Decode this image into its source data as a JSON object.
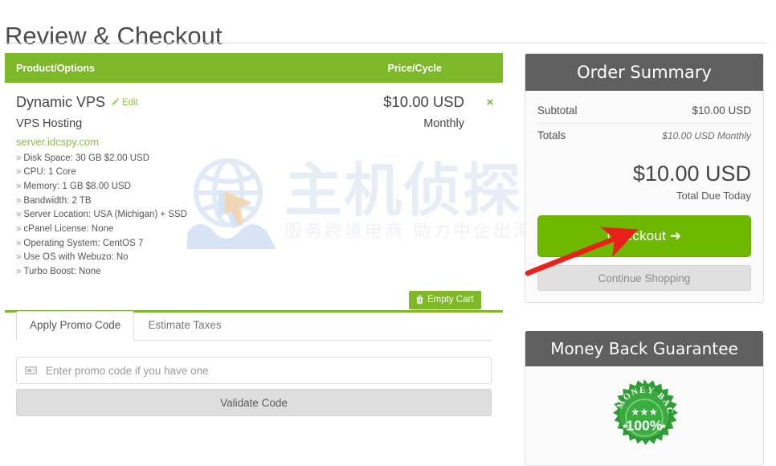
{
  "page": {
    "title": "Review & Checkout"
  },
  "watermark": {
    "main_text": "主机侦探",
    "sub_text": "服务跨境电商  助力中企出海",
    "globe_icon": "globe-cursor-wave-icon",
    "color": "#e6edf7"
  },
  "colors": {
    "brand_green": "#7cb828",
    "checkout_green": "#6fb800",
    "panel_gray": "#5f5f5f",
    "link_green": "#8cc63e",
    "domain_green": "#8cb847",
    "annotation_red": "#e8211a"
  },
  "cart": {
    "columns": {
      "product": "Product/Options",
      "price": "Price/Cycle"
    },
    "item": {
      "name": "Dynamic VPS",
      "edit_label": "Edit",
      "edit_icon": "pencil-icon",
      "group": "VPS Hosting",
      "domain": "server.idcspy.com",
      "price": "$10.00 USD",
      "cycle": "Monthly",
      "remove_icon": "×",
      "options": [
        "Disk Space: 30 GB $2.00 USD",
        "CPU: 1 Core",
        "Memory: 1 GB $8.00 USD",
        "Bandwidth: 2 TB",
        "Server Location: USA (Michigan) + SSD",
        "cPanel License: None",
        "Operating System: CentOS 7",
        "Use OS with Webuzo: No",
        "Turbo Boost: None"
      ]
    },
    "empty_cart": {
      "label": "Empty Cart",
      "icon": "trash-icon"
    }
  },
  "tabs": [
    {
      "label": "Apply Promo Code",
      "active": true
    },
    {
      "label": "Estimate Taxes",
      "active": false
    }
  ],
  "promo": {
    "icon": "ticket-icon",
    "placeholder": "Enter promo code if you have one",
    "value": "",
    "validate_label": "Validate Code"
  },
  "order_summary": {
    "heading": "Order Summary",
    "rows": [
      {
        "label": "Subtotal",
        "value": "$10.00 USD",
        "italic": false
      },
      {
        "label": "Totals",
        "value": "$10.00 USD Monthly",
        "italic": true
      }
    ],
    "total_amount": "$10.00 USD",
    "total_label": "Total Due Today",
    "checkout_label": "Checkout ➜",
    "continue_label": "Continue Shopping"
  },
  "guarantee": {
    "heading": "Money Back Guarantee",
    "badge": {
      "icon": "money-back-seal-icon",
      "arc_text": "MONEY BACK",
      "percent_text": "100%",
      "stars": "★★★"
    }
  },
  "annotation": {
    "type": "red-arrow",
    "points_to": "checkout-button",
    "from": "658,338",
    "to": "772,294"
  }
}
